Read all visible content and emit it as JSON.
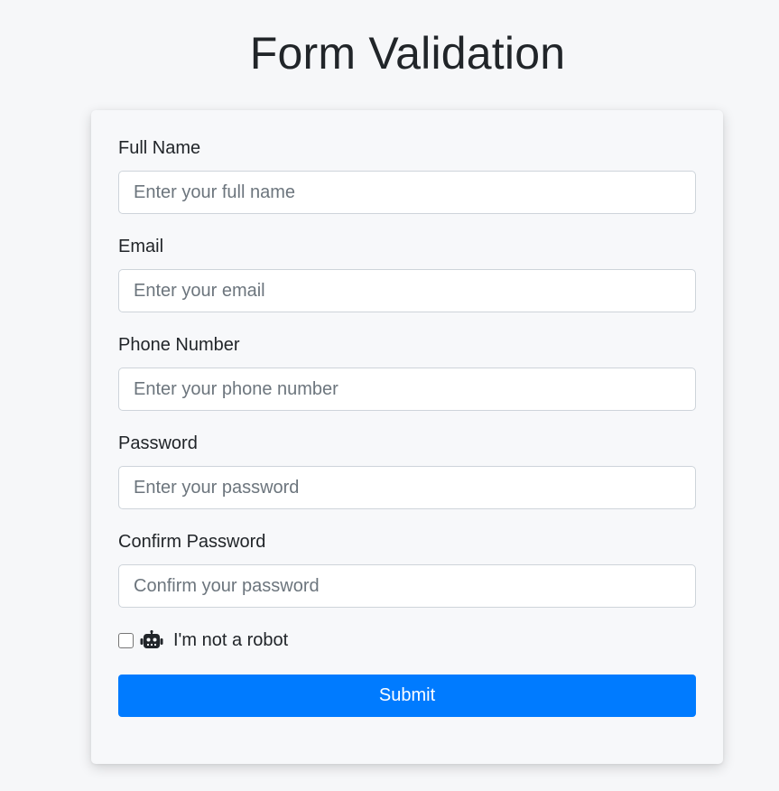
{
  "page": {
    "title": "Form Validation"
  },
  "form": {
    "fields": [
      {
        "label": "Full Name",
        "placeholder": "Enter your full name",
        "value": ""
      },
      {
        "label": "Email",
        "placeholder": "Enter your email",
        "value": ""
      },
      {
        "label": "Phone Number",
        "placeholder": "Enter your phone number",
        "value": ""
      },
      {
        "label": "Password",
        "placeholder": "Enter your password",
        "value": ""
      },
      {
        "label": "Confirm Password",
        "placeholder": "Confirm your password",
        "value": ""
      }
    ],
    "robot_check": {
      "label": "I'm not a robot",
      "checked": false,
      "icon": "robot-icon"
    },
    "submit_label": "Submit"
  },
  "colors": {
    "accent": "#007bff",
    "background": "#f6f7f9",
    "text": "#212529",
    "placeholder": "#6c757d",
    "input_border": "#ced4da"
  }
}
